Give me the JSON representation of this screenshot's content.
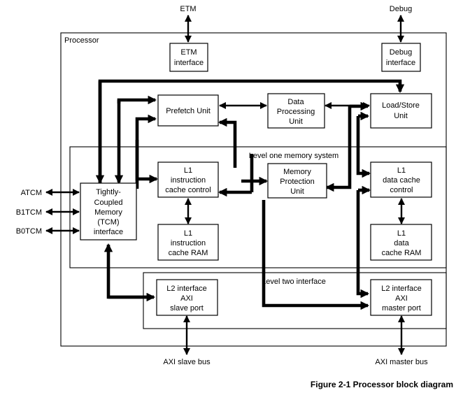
{
  "figure": {
    "caption": "Figure 2-1 Processor block diagram"
  },
  "containers": {
    "processor": {
      "label": "Processor"
    },
    "level_one": {
      "label": "Level one memory system"
    },
    "level_two": {
      "label": "Level two interface"
    }
  },
  "blocks": {
    "etm_interface": {
      "line1": "ETM",
      "line2": "interface"
    },
    "debug_interface": {
      "line1": "Debug",
      "line2": "interface"
    },
    "prefetch_unit": {
      "line1": "Prefetch Unit"
    },
    "data_processing_unit": {
      "line1": "Data",
      "line2": "Processing",
      "line3": "Unit"
    },
    "load_store_unit": {
      "line1": "Load/Store",
      "line2": "Unit"
    },
    "tcm_interface": {
      "line1": "Tightly-",
      "line2": "Coupled",
      "line3": "Memory",
      "line4": "(TCM)",
      "line5": "interface"
    },
    "l1_instruction_cache_control": {
      "line1": "L1",
      "line2": "instruction",
      "line3": "cache control"
    },
    "l1_instruction_cache_ram": {
      "line1": "L1",
      "line2": "instruction",
      "line3": "cache RAM"
    },
    "memory_protection_unit": {
      "line1": "Memory",
      "line2": "Protection",
      "line3": "Unit"
    },
    "l1_data_cache_control": {
      "line1": "L1",
      "line2": "data cache",
      "line3": "control"
    },
    "l1_data_cache_ram": {
      "line1": "L1",
      "line2": "data",
      "line3": "cache RAM"
    },
    "l2_axi_slave_port": {
      "line1": "L2 interface",
      "line2": "AXI",
      "line3": "slave port"
    },
    "l2_axi_master_port": {
      "line1": "L2 interface",
      "line2": "AXI",
      "line3": "master port"
    }
  },
  "external_ports": {
    "etm": {
      "label": "ETM"
    },
    "debug": {
      "label": "Debug"
    },
    "atcm": {
      "label": "ATCM"
    },
    "b1tcm": {
      "label": "B1TCM"
    },
    "b0tcm": {
      "label": "B0TCM"
    },
    "axi_slave_bus": {
      "label": "AXI slave bus"
    },
    "axi_master_bus": {
      "label": "AXI master bus"
    }
  },
  "colors": {
    "background": "#ffffff",
    "stroke": "#000000",
    "box_fill": "#ffffff"
  }
}
